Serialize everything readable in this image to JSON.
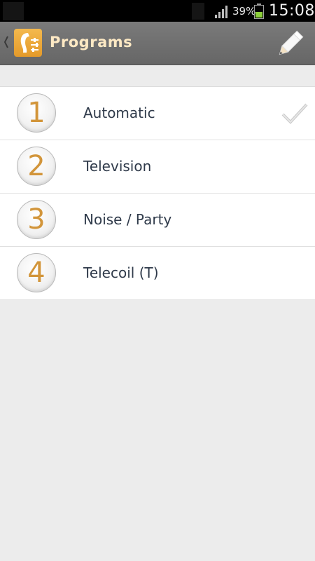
{
  "status_bar": {
    "battery_percent": "39%",
    "time": "15:08"
  },
  "action_bar": {
    "title": "Programs",
    "icons": {
      "back": "chevron-left-icon",
      "logo": "hearing-aid-app-icon",
      "edit": "pencil-icon"
    }
  },
  "programs": {
    "items": [
      {
        "number": "1",
        "label": "Automatic",
        "selected": true
      },
      {
        "number": "2",
        "label": "Television",
        "selected": false
      },
      {
        "number": "3",
        "label": "Noise / Party",
        "selected": false
      },
      {
        "number": "4",
        "label": "Telecoil (T)",
        "selected": false
      }
    ]
  },
  "colors": {
    "action_bar": "#707070",
    "title": "#fde9c4",
    "accent_number": "#d2953a",
    "label_text": "#2f3a4a",
    "background": "#ececec"
  }
}
